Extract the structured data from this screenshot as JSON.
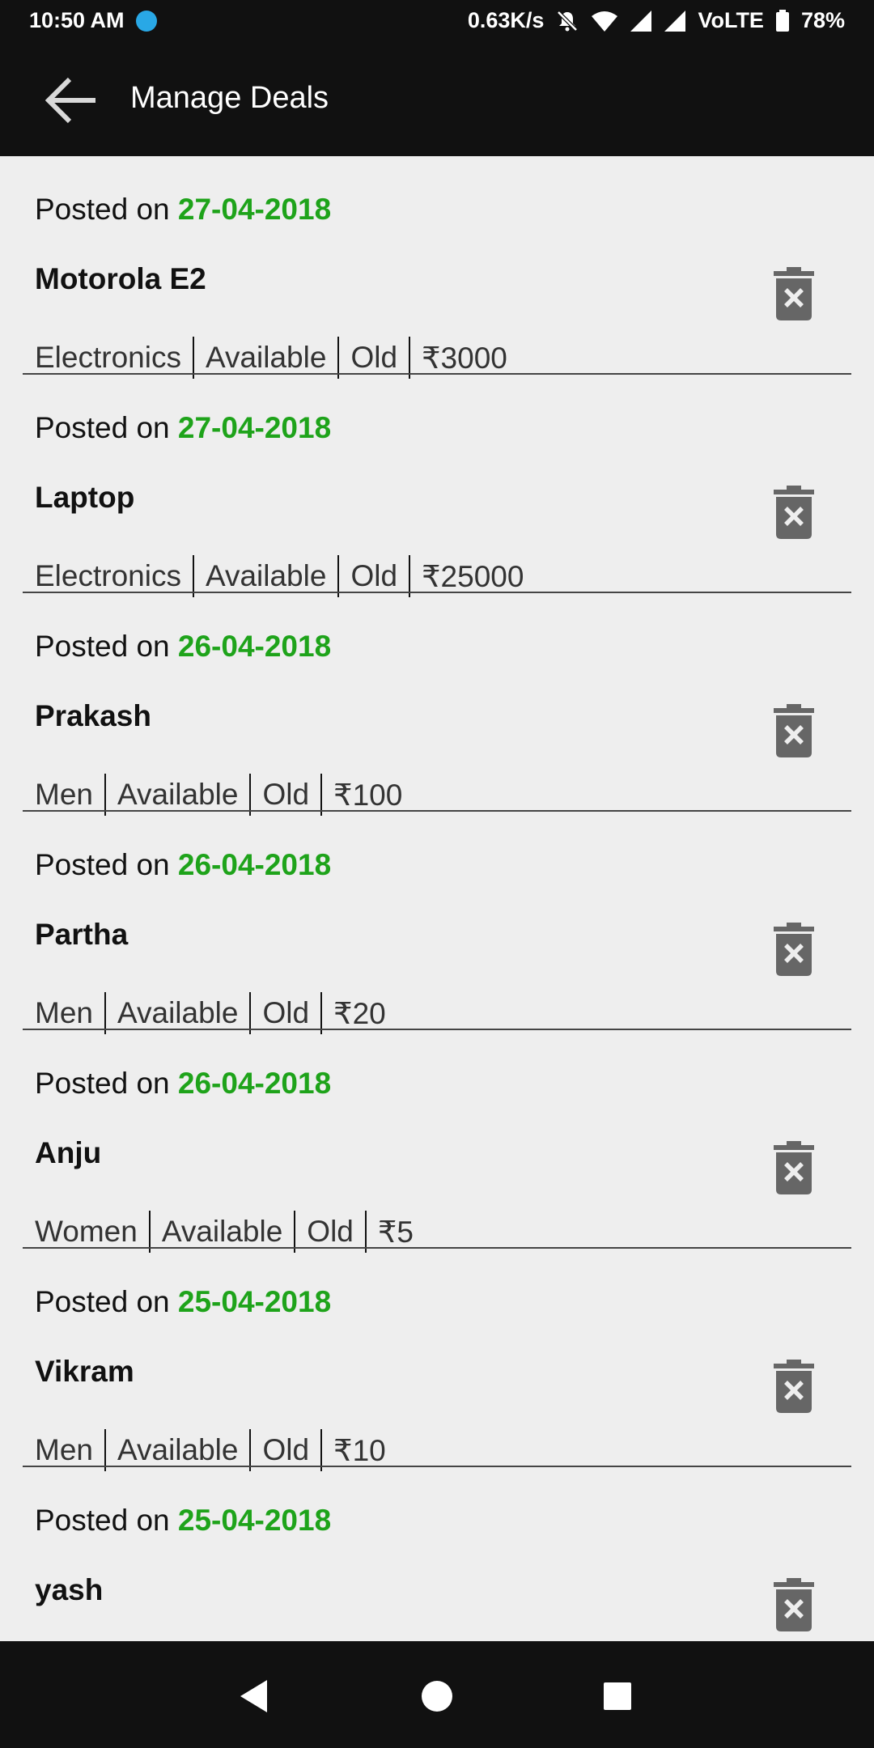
{
  "status_bar": {
    "time": "10:50 AM",
    "speed": "0.63K/s",
    "network": "VoLTE",
    "battery": "78%"
  },
  "app_bar": {
    "title": "Manage Deals"
  },
  "colors": {
    "date_green": "#1ea31a",
    "bar_bg": "#111111",
    "page_bg": "#eeeeee",
    "icon_gray": "#666666"
  },
  "icons": {
    "back": "arrow-left-icon",
    "delete": "trash-x-icon",
    "nav_back": "triangle-back-icon",
    "nav_home": "circle-home-icon",
    "nav_recents": "square-recents-icon"
  },
  "deals": [
    {
      "posted_label": "Posted on ",
      "date": "27-04-2018",
      "name": "Motorola E2",
      "category": "Electronics",
      "availability": "Available",
      "condition": "Old",
      "price": "₹3000"
    },
    {
      "posted_label": "Posted on ",
      "date": "27-04-2018",
      "name": "Laptop",
      "category": "Electronics",
      "availability": "Available",
      "condition": "Old",
      "price": "₹25000"
    },
    {
      "posted_label": "Posted on ",
      "date": "26-04-2018",
      "name": "Prakash",
      "category": "Men",
      "availability": "Available",
      "condition": "Old",
      "price": "₹100"
    },
    {
      "posted_label": "Posted on ",
      "date": "26-04-2018",
      "name": "Partha",
      "category": "Men",
      "availability": "Available",
      "condition": "Old",
      "price": "₹20"
    },
    {
      "posted_label": "Posted on ",
      "date": "26-04-2018",
      "name": "Anju",
      "category": "Women",
      "availability": "Available",
      "condition": "Old",
      "price": "₹5"
    },
    {
      "posted_label": "Posted on ",
      "date": "25-04-2018",
      "name": "Vikram",
      "category": "Men",
      "availability": "Available",
      "condition": "Old",
      "price": "₹10"
    },
    {
      "posted_label": "Posted on ",
      "date": "25-04-2018",
      "name": "yash"
    }
  ]
}
